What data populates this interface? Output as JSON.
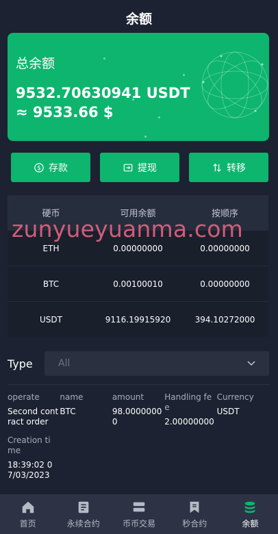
{
  "header": {
    "title": "余额"
  },
  "balance": {
    "label": "总余额",
    "amount": "9532.70630941 USDT",
    "fiat": "≈ 9533.66 $"
  },
  "actions": [
    {
      "label": "存款",
      "icon": "dollar-circle-icon"
    },
    {
      "label": "提现",
      "icon": "withdraw-icon"
    },
    {
      "label": "转移",
      "icon": "transfer-arrows-icon"
    }
  ],
  "table": {
    "headers": [
      "硬币",
      "可用余额",
      "按顺序"
    ],
    "rows": [
      [
        "ETH",
        "0.00000000",
        "0.00000000"
      ],
      [
        "BTC",
        "0.00100010",
        "0.00000000"
      ],
      [
        "USDT",
        "9116.19915920",
        "394.10272000"
      ]
    ]
  },
  "watermark": "zunyueyuanma.com",
  "filter": {
    "label": "Type",
    "selected": "All"
  },
  "record": {
    "operate_key": "operate",
    "operate_val": "Second contract order",
    "name_key": "name",
    "name_val": "BTC",
    "amount_key": "amount",
    "amount_val": "98.00000000",
    "fee_key": "Handling fee",
    "fee_val": "2.00000000",
    "currency_key": "Currency",
    "currency_val": "USDT",
    "time_key": "Creation time",
    "time_val": "18:39:02 07/03/2023"
  },
  "tabs": [
    {
      "label": "首页",
      "icon": "home-icon"
    },
    {
      "label": "永续合约",
      "icon": "contract-book-icon"
    },
    {
      "label": "币币交易",
      "icon": "exchange-stack-icon"
    },
    {
      "label": "秒合约",
      "icon": "bookmark-icon"
    },
    {
      "label": "余额",
      "icon": "coins-stack-icon",
      "active": true
    }
  ],
  "colors": {
    "accent": "#0db56e",
    "background": "#1c2231",
    "watermark": "#e26280"
  }
}
